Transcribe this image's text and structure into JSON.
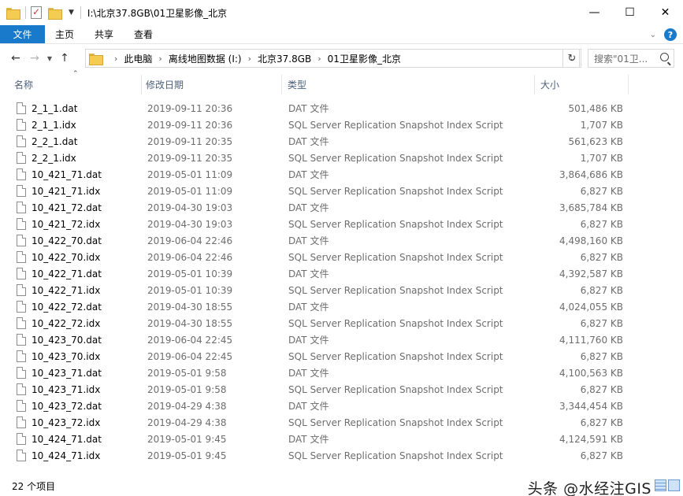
{
  "window": {
    "title": "I:\\北京37.8GB\\01卫星影像_北京"
  },
  "ribbon": {
    "tabs": [
      {
        "label": "文件"
      },
      {
        "label": "主页"
      },
      {
        "label": "共享"
      },
      {
        "label": "查看"
      }
    ],
    "help_label": "?"
  },
  "address": {
    "crumbs": [
      "此电脑",
      "离线地图数据 (I:)",
      "北京37.8GB",
      "01卫星影像_北京"
    ],
    "search_placeholder": "搜索\"01卫..."
  },
  "columns": {
    "name": "名称",
    "date": "修改日期",
    "type": "类型",
    "size": "大小"
  },
  "files": [
    {
      "name": "2_1_1.dat",
      "date": "2019-09-11 20:36",
      "type": "DAT 文件",
      "size": "501,486 KB"
    },
    {
      "name": "2_1_1.idx",
      "date": "2019-09-11 20:36",
      "type": "SQL Server Replication Snapshot Index Script",
      "size": "1,707 KB"
    },
    {
      "name": "2_2_1.dat",
      "date": "2019-09-11 20:35",
      "type": "DAT 文件",
      "size": "561,623 KB"
    },
    {
      "name": "2_2_1.idx",
      "date": "2019-09-11 20:35",
      "type": "SQL Server Replication Snapshot Index Script",
      "size": "1,707 KB"
    },
    {
      "name": "10_421_71.dat",
      "date": "2019-05-01 11:09",
      "type": "DAT 文件",
      "size": "3,864,686 KB"
    },
    {
      "name": "10_421_71.idx",
      "date": "2019-05-01 11:09",
      "type": "SQL Server Replication Snapshot Index Script",
      "size": "6,827 KB"
    },
    {
      "name": "10_421_72.dat",
      "date": "2019-04-30 19:03",
      "type": "DAT 文件",
      "size": "3,685,784 KB"
    },
    {
      "name": "10_421_72.idx",
      "date": "2019-04-30 19:03",
      "type": "SQL Server Replication Snapshot Index Script",
      "size": "6,827 KB"
    },
    {
      "name": "10_422_70.dat",
      "date": "2019-06-04 22:46",
      "type": "DAT 文件",
      "size": "4,498,160 KB"
    },
    {
      "name": "10_422_70.idx",
      "date": "2019-06-04 22:46",
      "type": "SQL Server Replication Snapshot Index Script",
      "size": "6,827 KB"
    },
    {
      "name": "10_422_71.dat",
      "date": "2019-05-01 10:39",
      "type": "DAT 文件",
      "size": "4,392,587 KB"
    },
    {
      "name": "10_422_71.idx",
      "date": "2019-05-01 10:39",
      "type": "SQL Server Replication Snapshot Index Script",
      "size": "6,827 KB"
    },
    {
      "name": "10_422_72.dat",
      "date": "2019-04-30 18:55",
      "type": "DAT 文件",
      "size": "4,024,055 KB"
    },
    {
      "name": "10_422_72.idx",
      "date": "2019-04-30 18:55",
      "type": "SQL Server Replication Snapshot Index Script",
      "size": "6,827 KB"
    },
    {
      "name": "10_423_70.dat",
      "date": "2019-06-04 22:45",
      "type": "DAT 文件",
      "size": "4,111,760 KB"
    },
    {
      "name": "10_423_70.idx",
      "date": "2019-06-04 22:45",
      "type": "SQL Server Replication Snapshot Index Script",
      "size": "6,827 KB"
    },
    {
      "name": "10_423_71.dat",
      "date": "2019-05-01 9:58",
      "type": "DAT 文件",
      "size": "4,100,563 KB"
    },
    {
      "name": "10_423_71.idx",
      "date": "2019-05-01 9:58",
      "type": "SQL Server Replication Snapshot Index Script",
      "size": "6,827 KB"
    },
    {
      "name": "10_423_72.dat",
      "date": "2019-04-29 4:38",
      "type": "DAT 文件",
      "size": "3,344,454 KB"
    },
    {
      "name": "10_423_72.idx",
      "date": "2019-04-29 4:38",
      "type": "SQL Server Replication Snapshot Index Script",
      "size": "6,827 KB"
    },
    {
      "name": "10_424_71.dat",
      "date": "2019-05-01 9:45",
      "type": "DAT 文件",
      "size": "4,124,591 KB"
    },
    {
      "name": "10_424_71.idx",
      "date": "2019-05-01 9:45",
      "type": "SQL Server Replication Snapshot Index Script",
      "size": "6,827 KB"
    }
  ],
  "status": {
    "item_count": "22 个项目",
    "watermark": "头条 @水经注GIS"
  },
  "colors": {
    "accent": "#1979ca",
    "header_text": "#4c607a",
    "secondary_text": "#6d6d6d"
  },
  "icons": {
    "back": "arrow-left-icon",
    "forward": "arrow-right-icon",
    "up": "arrow-up-icon",
    "refresh": "refresh-icon",
    "search": "search-icon",
    "file": "document-icon",
    "folder": "folder-icon"
  }
}
